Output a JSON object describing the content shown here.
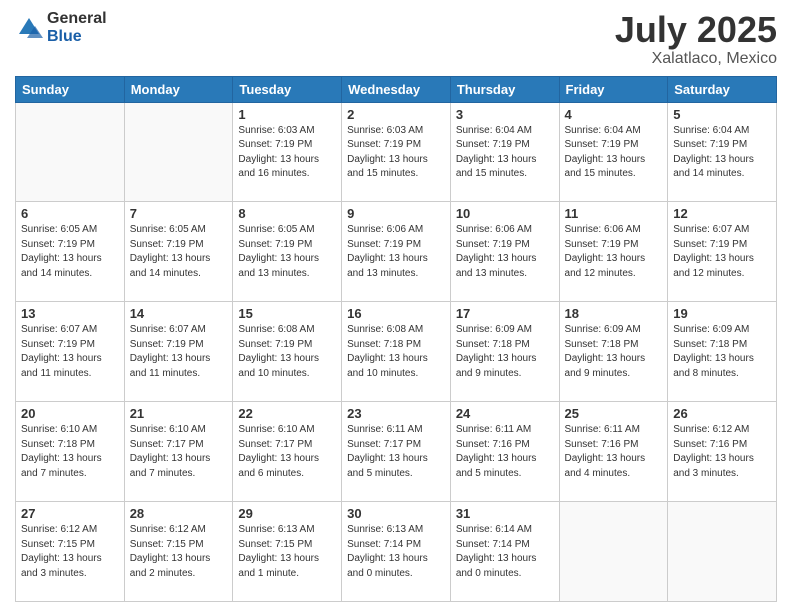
{
  "header": {
    "logo_general": "General",
    "logo_blue": "Blue",
    "main_title": "July 2025",
    "sub_title": "Xalatlaco, Mexico"
  },
  "calendar": {
    "days_of_week": [
      "Sunday",
      "Monday",
      "Tuesday",
      "Wednesday",
      "Thursday",
      "Friday",
      "Saturday"
    ],
    "weeks": [
      [
        {
          "day": "",
          "info": ""
        },
        {
          "day": "",
          "info": ""
        },
        {
          "day": "1",
          "info": "Sunrise: 6:03 AM\nSunset: 7:19 PM\nDaylight: 13 hours\nand 16 minutes."
        },
        {
          "day": "2",
          "info": "Sunrise: 6:03 AM\nSunset: 7:19 PM\nDaylight: 13 hours\nand 15 minutes."
        },
        {
          "day": "3",
          "info": "Sunrise: 6:04 AM\nSunset: 7:19 PM\nDaylight: 13 hours\nand 15 minutes."
        },
        {
          "day": "4",
          "info": "Sunrise: 6:04 AM\nSunset: 7:19 PM\nDaylight: 13 hours\nand 15 minutes."
        },
        {
          "day": "5",
          "info": "Sunrise: 6:04 AM\nSunset: 7:19 PM\nDaylight: 13 hours\nand 14 minutes."
        }
      ],
      [
        {
          "day": "6",
          "info": "Sunrise: 6:05 AM\nSunset: 7:19 PM\nDaylight: 13 hours\nand 14 minutes."
        },
        {
          "day": "7",
          "info": "Sunrise: 6:05 AM\nSunset: 7:19 PM\nDaylight: 13 hours\nand 14 minutes."
        },
        {
          "day": "8",
          "info": "Sunrise: 6:05 AM\nSunset: 7:19 PM\nDaylight: 13 hours\nand 13 minutes."
        },
        {
          "day": "9",
          "info": "Sunrise: 6:06 AM\nSunset: 7:19 PM\nDaylight: 13 hours\nand 13 minutes."
        },
        {
          "day": "10",
          "info": "Sunrise: 6:06 AM\nSunset: 7:19 PM\nDaylight: 13 hours\nand 13 minutes."
        },
        {
          "day": "11",
          "info": "Sunrise: 6:06 AM\nSunset: 7:19 PM\nDaylight: 13 hours\nand 12 minutes."
        },
        {
          "day": "12",
          "info": "Sunrise: 6:07 AM\nSunset: 7:19 PM\nDaylight: 13 hours\nand 12 minutes."
        }
      ],
      [
        {
          "day": "13",
          "info": "Sunrise: 6:07 AM\nSunset: 7:19 PM\nDaylight: 13 hours\nand 11 minutes."
        },
        {
          "day": "14",
          "info": "Sunrise: 6:07 AM\nSunset: 7:19 PM\nDaylight: 13 hours\nand 11 minutes."
        },
        {
          "day": "15",
          "info": "Sunrise: 6:08 AM\nSunset: 7:19 PM\nDaylight: 13 hours\nand 10 minutes."
        },
        {
          "day": "16",
          "info": "Sunrise: 6:08 AM\nSunset: 7:18 PM\nDaylight: 13 hours\nand 10 minutes."
        },
        {
          "day": "17",
          "info": "Sunrise: 6:09 AM\nSunset: 7:18 PM\nDaylight: 13 hours\nand 9 minutes."
        },
        {
          "day": "18",
          "info": "Sunrise: 6:09 AM\nSunset: 7:18 PM\nDaylight: 13 hours\nand 9 minutes."
        },
        {
          "day": "19",
          "info": "Sunrise: 6:09 AM\nSunset: 7:18 PM\nDaylight: 13 hours\nand 8 minutes."
        }
      ],
      [
        {
          "day": "20",
          "info": "Sunrise: 6:10 AM\nSunset: 7:18 PM\nDaylight: 13 hours\nand 7 minutes."
        },
        {
          "day": "21",
          "info": "Sunrise: 6:10 AM\nSunset: 7:17 PM\nDaylight: 13 hours\nand 7 minutes."
        },
        {
          "day": "22",
          "info": "Sunrise: 6:10 AM\nSunset: 7:17 PM\nDaylight: 13 hours\nand 6 minutes."
        },
        {
          "day": "23",
          "info": "Sunrise: 6:11 AM\nSunset: 7:17 PM\nDaylight: 13 hours\nand 5 minutes."
        },
        {
          "day": "24",
          "info": "Sunrise: 6:11 AM\nSunset: 7:16 PM\nDaylight: 13 hours\nand 5 minutes."
        },
        {
          "day": "25",
          "info": "Sunrise: 6:11 AM\nSunset: 7:16 PM\nDaylight: 13 hours\nand 4 minutes."
        },
        {
          "day": "26",
          "info": "Sunrise: 6:12 AM\nSunset: 7:16 PM\nDaylight: 13 hours\nand 3 minutes."
        }
      ],
      [
        {
          "day": "27",
          "info": "Sunrise: 6:12 AM\nSunset: 7:15 PM\nDaylight: 13 hours\nand 3 minutes."
        },
        {
          "day": "28",
          "info": "Sunrise: 6:12 AM\nSunset: 7:15 PM\nDaylight: 13 hours\nand 2 minutes."
        },
        {
          "day": "29",
          "info": "Sunrise: 6:13 AM\nSunset: 7:15 PM\nDaylight: 13 hours\nand 1 minute."
        },
        {
          "day": "30",
          "info": "Sunrise: 6:13 AM\nSunset: 7:14 PM\nDaylight: 13 hours\nand 0 minutes."
        },
        {
          "day": "31",
          "info": "Sunrise: 6:14 AM\nSunset: 7:14 PM\nDaylight: 13 hours\nand 0 minutes."
        },
        {
          "day": "",
          "info": ""
        },
        {
          "day": "",
          "info": ""
        }
      ]
    ]
  }
}
